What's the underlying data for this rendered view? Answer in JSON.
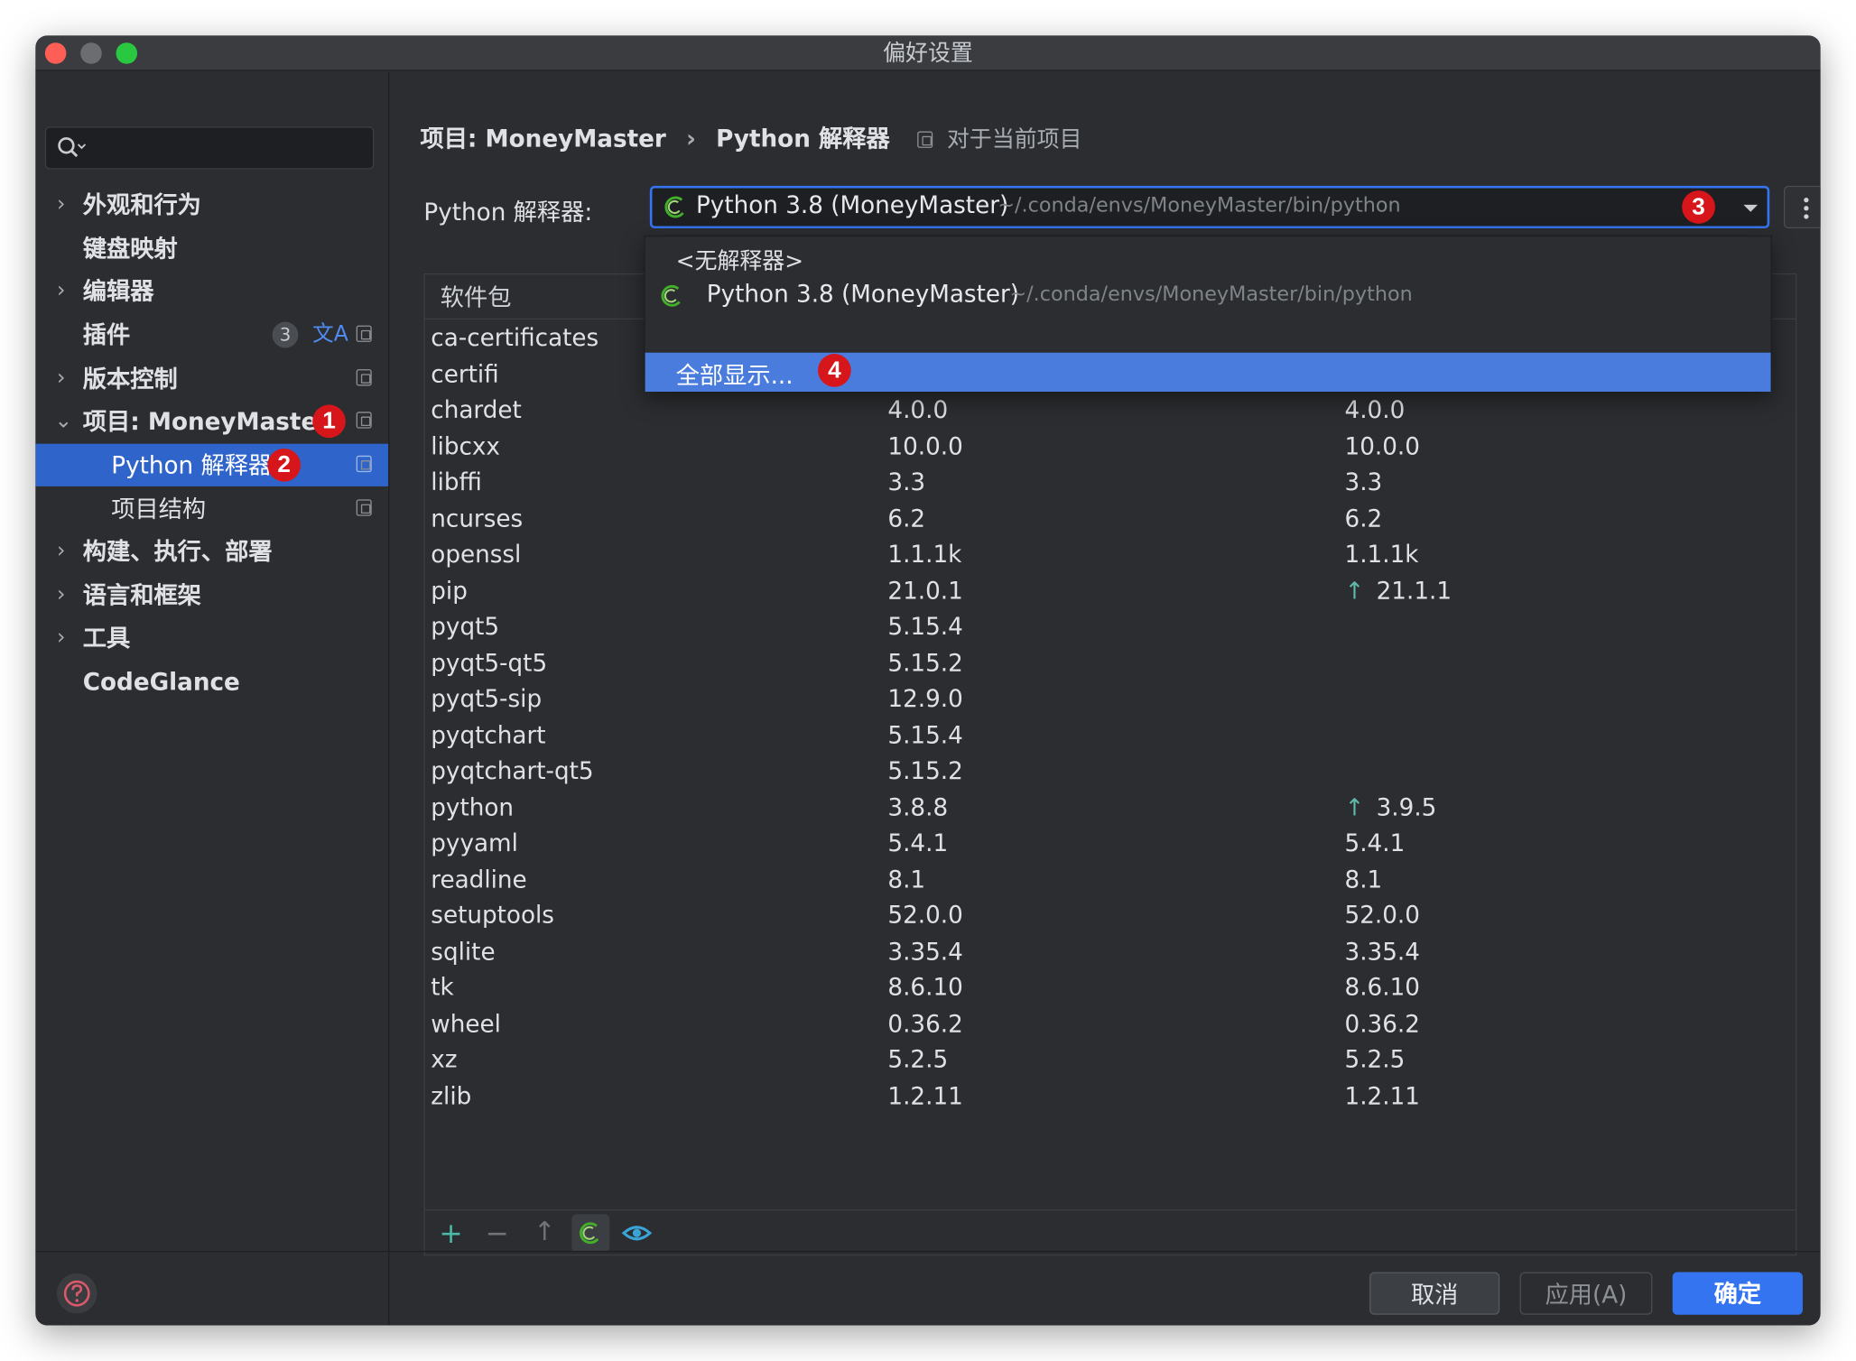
{
  "window": {
    "title": "偏好设置"
  },
  "sidebar": {
    "search_placeholder": "",
    "items": [
      {
        "label": "外观和行为"
      },
      {
        "label": "键盘映射"
      },
      {
        "label": "编辑器"
      },
      {
        "label": "插件",
        "badge": "3"
      },
      {
        "label": "版本控制"
      },
      {
        "label": "项目: MoneyMaster",
        "marker": "1"
      },
      {
        "label": "Python 解释器",
        "marker": "2"
      },
      {
        "label": "项目结构"
      },
      {
        "label": "构建、执行、部署"
      },
      {
        "label": "语言和框架"
      },
      {
        "label": "工具"
      },
      {
        "label": "CodeGlance"
      }
    ]
  },
  "breadcrumb": {
    "project": "项目: MoneyMaster",
    "separator": "›",
    "page": "Python 解释器",
    "scope": "对于当前项目"
  },
  "interpreter": {
    "label": "Python 解释器:",
    "selected_name": "Python 3.8 (MoneyMaster)",
    "selected_path": "~/.conda/envs/MoneyMaster/bin/python",
    "marker": "3"
  },
  "dropdown": {
    "no_interpreter": "<无解释器>",
    "option_name": "Python 3.8 (MoneyMaster)",
    "option_path": "~/.conda/envs/MoneyMaster/bin/python",
    "show_all": "全部显示...",
    "marker": "4"
  },
  "table": {
    "header_package": "软件包",
    "rows": [
      {
        "name": "ca-certificates",
        "version": "",
        "latest": "",
        "upgrade": false
      },
      {
        "name": "certifi",
        "version": "",
        "latest": "",
        "upgrade": false
      },
      {
        "name": "chardet",
        "version": "4.0.0",
        "latest": "4.0.0",
        "upgrade": false
      },
      {
        "name": "libcxx",
        "version": "10.0.0",
        "latest": "10.0.0",
        "upgrade": false
      },
      {
        "name": "libffi",
        "version": "3.3",
        "latest": "3.3",
        "upgrade": false
      },
      {
        "name": "ncurses",
        "version": "6.2",
        "latest": "6.2",
        "upgrade": false
      },
      {
        "name": "openssl",
        "version": "1.1.1k",
        "latest": "1.1.1k",
        "upgrade": false
      },
      {
        "name": "pip",
        "version": "21.0.1",
        "latest": "21.1.1",
        "upgrade": true
      },
      {
        "name": "pyqt5",
        "version": "5.15.4",
        "latest": "",
        "upgrade": false
      },
      {
        "name": "pyqt5-qt5",
        "version": "5.15.2",
        "latest": "",
        "upgrade": false
      },
      {
        "name": "pyqt5-sip",
        "version": "12.9.0",
        "latest": "",
        "upgrade": false
      },
      {
        "name": "pyqtchart",
        "version": "5.15.4",
        "latest": "",
        "upgrade": false
      },
      {
        "name": "pyqtchart-qt5",
        "version": "5.15.2",
        "latest": "",
        "upgrade": false
      },
      {
        "name": "python",
        "version": "3.8.8",
        "latest": "3.9.5",
        "upgrade": true
      },
      {
        "name": "pyyaml",
        "version": "5.4.1",
        "latest": "5.4.1",
        "upgrade": false
      },
      {
        "name": "readline",
        "version": "8.1",
        "latest": "8.1",
        "upgrade": false
      },
      {
        "name": "setuptools",
        "version": "52.0.0",
        "latest": "52.0.0",
        "upgrade": false
      },
      {
        "name": "sqlite",
        "version": "3.35.4",
        "latest": "3.35.4",
        "upgrade": false
      },
      {
        "name": "tk",
        "version": "8.6.10",
        "latest": "8.6.10",
        "upgrade": false
      },
      {
        "name": "wheel",
        "version": "0.36.2",
        "latest": "0.36.2",
        "upgrade": false
      },
      {
        "name": "xz",
        "version": "5.2.5",
        "latest": "5.2.5",
        "upgrade": false
      },
      {
        "name": "zlib",
        "version": "1.2.11",
        "latest": "1.2.11",
        "upgrade": false
      }
    ],
    "toolbar": {
      "add": "+",
      "remove": "−",
      "upgrade": "↑"
    }
  },
  "footer": {
    "cancel": "取消",
    "apply": "应用(A)",
    "ok": "确定"
  },
  "colors": {
    "accent": "#3574f0",
    "selection": "#2f65ca",
    "marker_red": "#d7161b",
    "upgrade_arrow": "#5fb8a8",
    "conda_green": "#43b02a"
  }
}
